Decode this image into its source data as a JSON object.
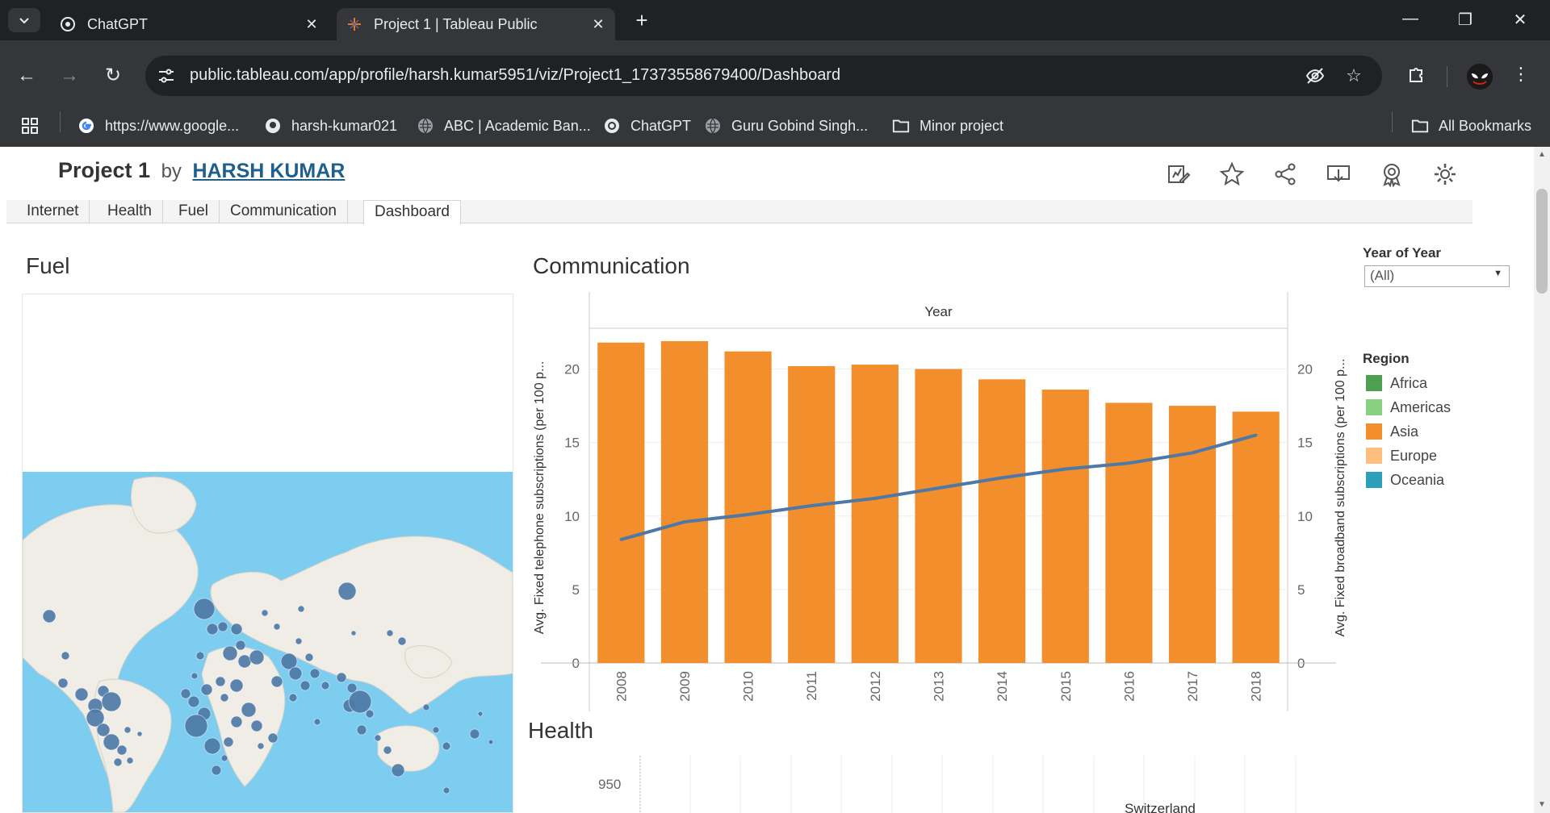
{
  "browser": {
    "tabs": [
      {
        "title": "ChatGPT",
        "active": false
      },
      {
        "title": "Project 1 | Tableau Public",
        "active": true
      }
    ],
    "url": "public.tableau.com/app/profile/harsh.kumar5951/viz/Project1_17373558679400/Dashboard",
    "bookmarks": [
      {
        "label": "https://www.google...",
        "icon": "google-icon"
      },
      {
        "label": "harsh-kumar021",
        "icon": "github-icon"
      },
      {
        "label": "ABC | Academic Ban...",
        "icon": "globe-icon"
      },
      {
        "label": "ChatGPT",
        "icon": "chatgpt-icon"
      },
      {
        "label": "Guru Gobind Singh...",
        "icon": "globe-icon"
      },
      {
        "label": "Minor project",
        "icon": "folder-icon"
      }
    ],
    "all_bookmarks": "All Bookmarks"
  },
  "viz": {
    "title": "Project 1",
    "by": "by",
    "author": "HARSH KUMAR",
    "tabs": [
      "Internet",
      "Health",
      "Fuel",
      "Communication",
      "Dashboard"
    ],
    "active_tab": "Dashboard"
  },
  "fuel": {
    "title": "Fuel"
  },
  "communication": {
    "title": "Communication"
  },
  "health": {
    "title": "Health",
    "tick_950": "950",
    "label_switzerland": "Switzerland"
  },
  "filter": {
    "title": "Year of Year",
    "value": "(All)"
  },
  "legend": {
    "title": "Region",
    "items": [
      {
        "label": "Africa",
        "color": "#4e9f50"
      },
      {
        "label": "Americas",
        "color": "#87d180"
      },
      {
        "label": "Asia",
        "color": "#f28e2b"
      },
      {
        "label": "Europe",
        "color": "#ffbe7d"
      },
      {
        "label": "Oceania",
        "color": "#2ca0b8"
      }
    ]
  },
  "chart_data": {
    "type": "bar",
    "title": "Communication",
    "column_header": "Year",
    "categories": [
      "2008",
      "2009",
      "2010",
      "2011",
      "2012",
      "2013",
      "2014",
      "2015",
      "2016",
      "2017",
      "2018"
    ],
    "series": [
      {
        "name": "Avg. Fixed telephone subscriptions (per 100 p...",
        "type": "bar",
        "color": "#f28e2b",
        "values": [
          21.8,
          21.9,
          21.2,
          20.2,
          20.3,
          20.0,
          19.3,
          18.6,
          17.7,
          17.5,
          17.1
        ]
      },
      {
        "name": "Avg. Fixed broadband subscriptions (per 100 p...",
        "type": "line",
        "color": "#4e79a7",
        "values": [
          8.4,
          9.6,
          10.1,
          10.7,
          11.2,
          11.9,
          12.6,
          13.2,
          13.6,
          14.3,
          15.5
        ]
      }
    ],
    "ylabel_left": "Avg. Fixed telephone subscriptions (per 100 p...",
    "ylabel_right": "Avg. Fixed broadband subscriptions (per 100 p...",
    "ylim": [
      0,
      22.5
    ],
    "yticks": [
      "0",
      "5",
      "10",
      "15",
      "20"
    ],
    "grid": true
  }
}
